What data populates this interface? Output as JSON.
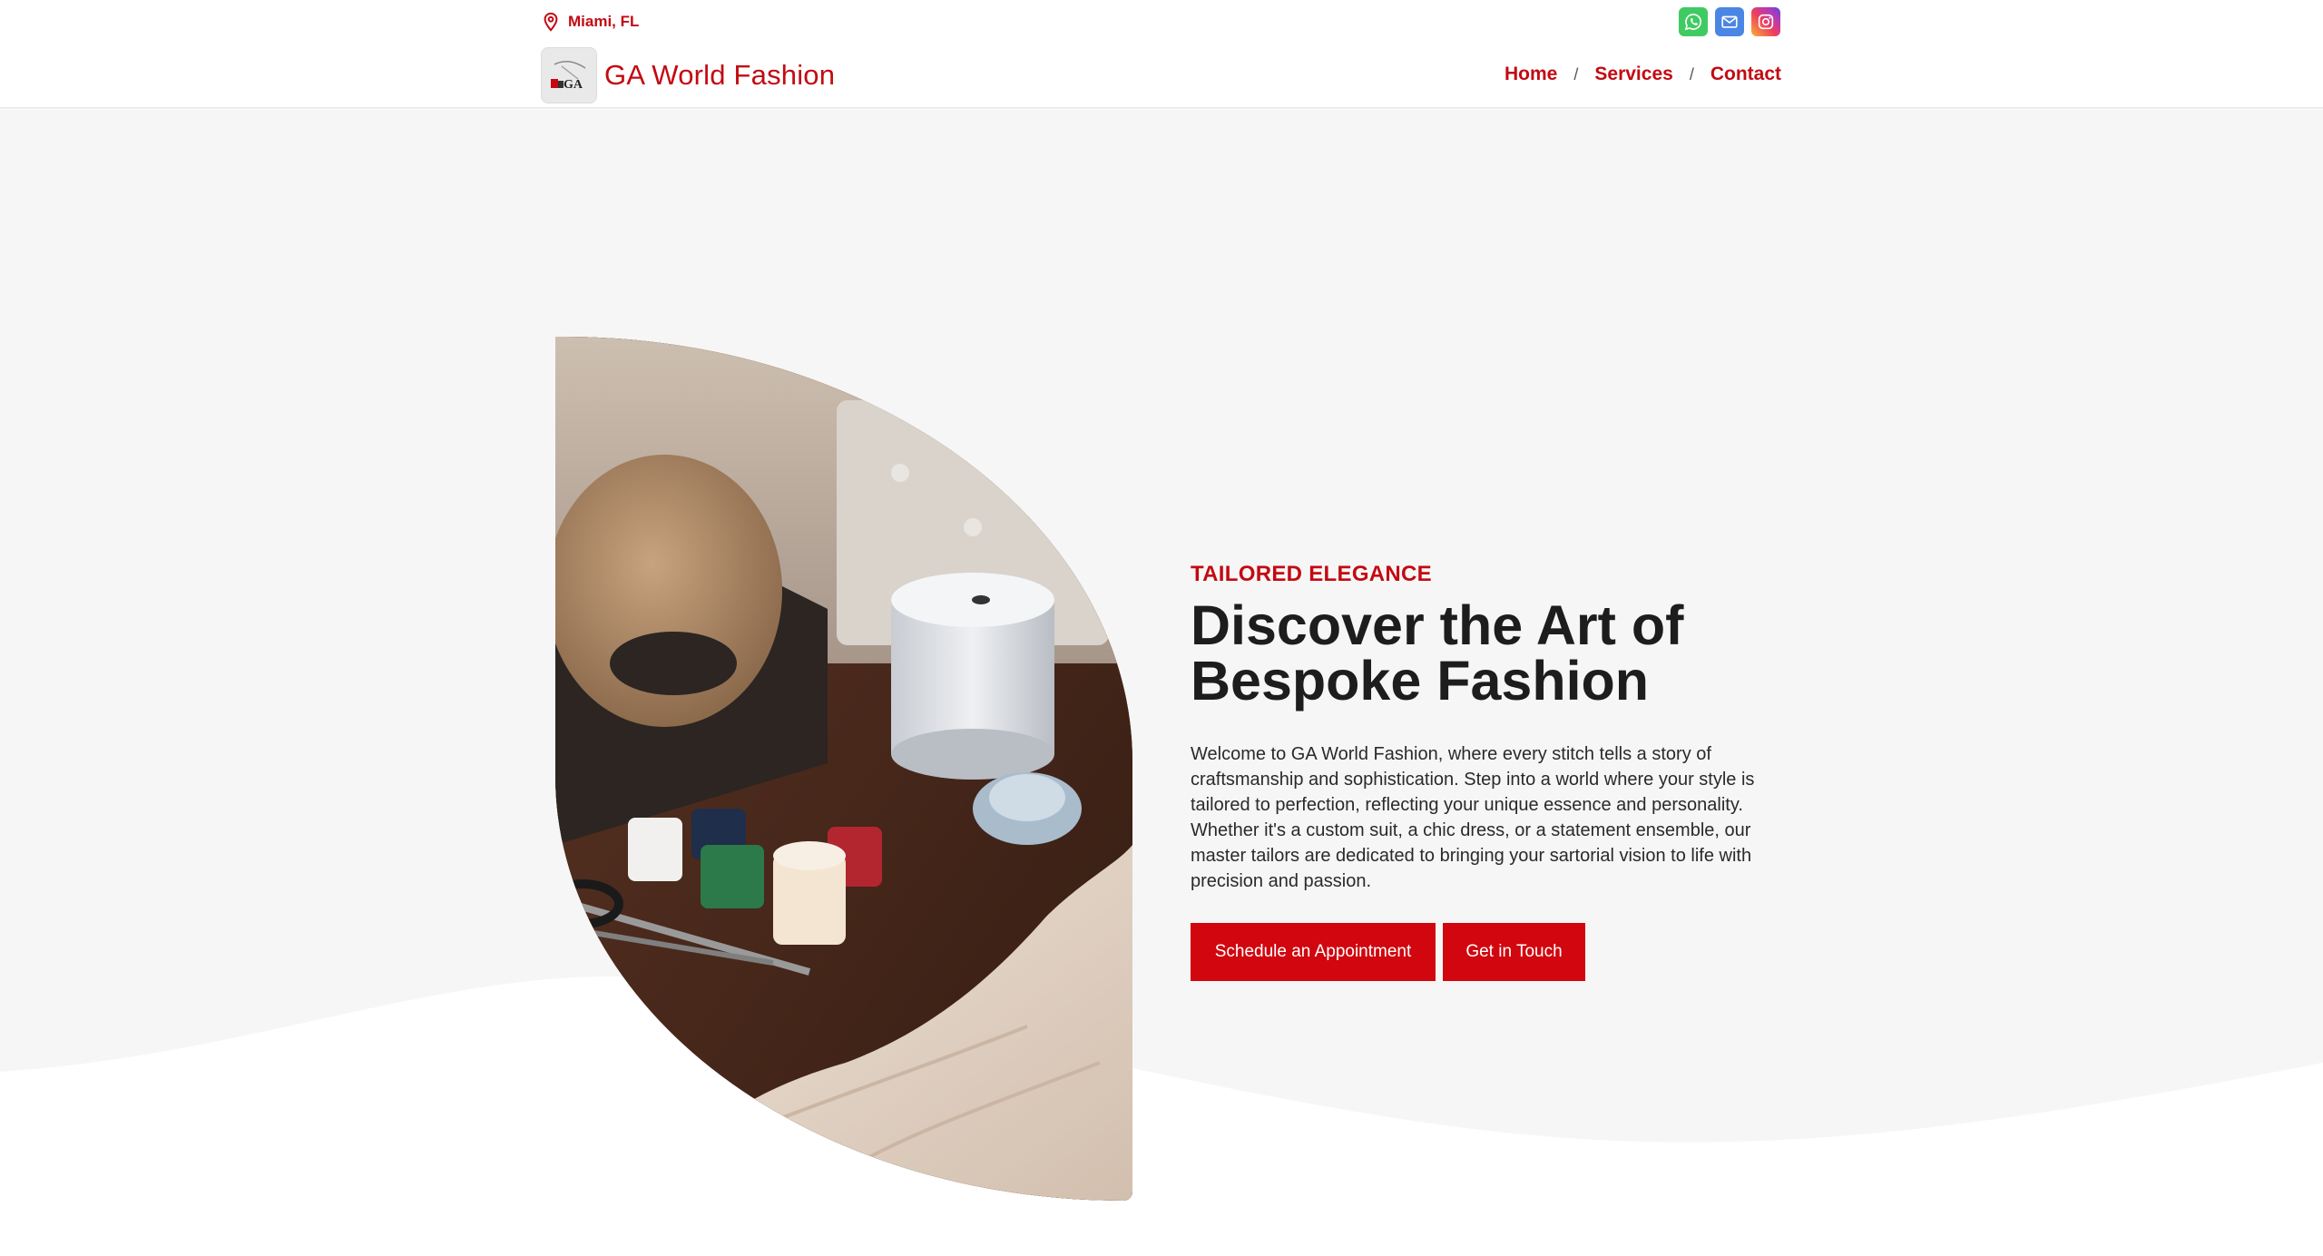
{
  "header": {
    "location": "Miami, FL",
    "location_icon": "map-pin-icon",
    "social_icons": [
      "whatsapp-icon",
      "email-icon",
      "instagram-icon"
    ],
    "brand_name": "GA World Fashion",
    "logo_text": "GA",
    "nav": [
      {
        "label": "Home"
      },
      {
        "label": "Services"
      },
      {
        "label": "Contact"
      }
    ],
    "nav_separator": "/"
  },
  "hero": {
    "eyebrow": "TAILORED ELEGANCE",
    "title_line_1": "Discover the Art of",
    "title_line_2": "Bespoke Fashion",
    "intro": "Welcome to GA World Fashion, where every stitch tells a story of craftsmanship and sophistication. Step into a world where your style is tailored to perfection, reflecting your unique essence and personality. Whether it's a custom suit, a chic dress, or a statement ensemble, our master tailors are dedicated to bringing your sartorial vision to life with precision and passion.",
    "primary_button": "Schedule an Appointment",
    "secondary_button": "Get in Touch",
    "image": "sewing-supplies-photo"
  },
  "colors": {
    "accent": "#c30a12",
    "button": "#d1060f",
    "hero_background": "#f6f6f6"
  }
}
